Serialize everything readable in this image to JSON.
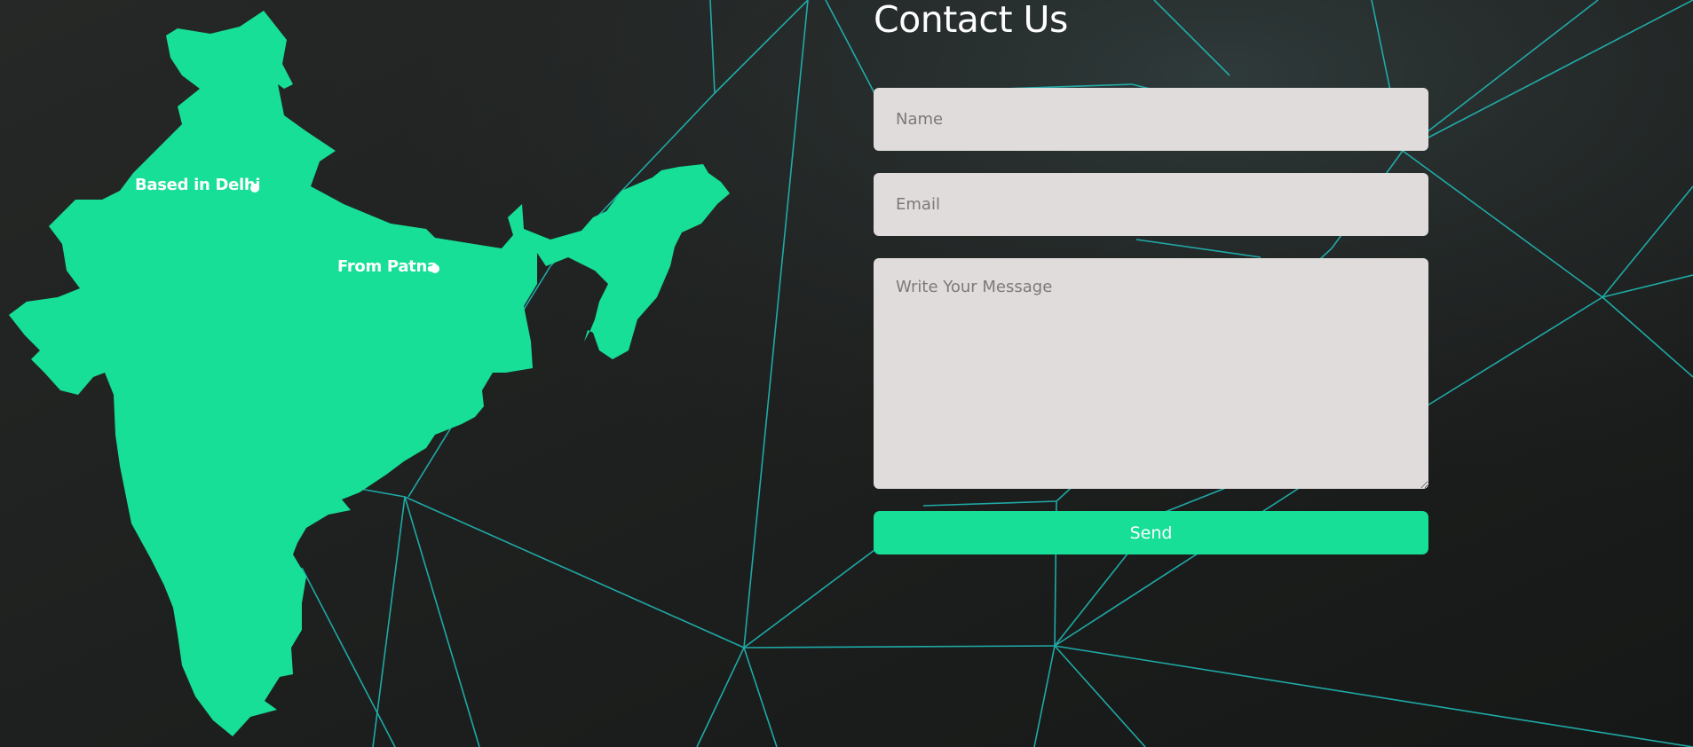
{
  "colors": {
    "background": "#1f2120",
    "accent": "#17df97",
    "network_lines": "#1fb9b5",
    "field_background": "#e0dcdb"
  },
  "map": {
    "region": "India",
    "labels": [
      {
        "text": "Based in Delhi"
      },
      {
        "text": "From Patna"
      }
    ]
  },
  "contact": {
    "title": "Contact Us",
    "name_placeholder": "Name",
    "email_placeholder": "Email",
    "message_placeholder": "Write Your Message",
    "send_label": "Send"
  }
}
